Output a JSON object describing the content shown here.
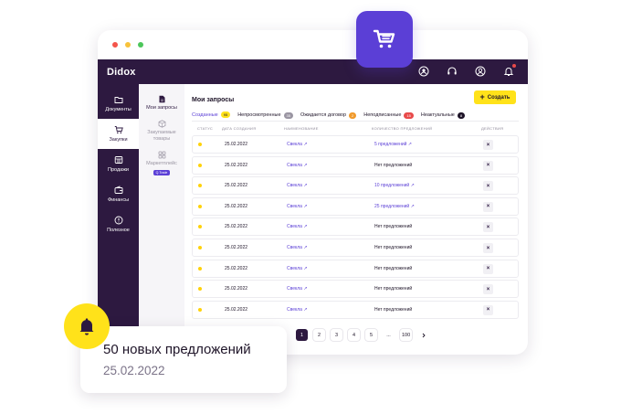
{
  "app": {
    "logo": "Didox"
  },
  "titlebar": {
    "dot_colors": [
      "#f4554b",
      "#f8c23a",
      "#4cc65a"
    ]
  },
  "topbar": {
    "icons": [
      "user-badge-icon",
      "headset-icon",
      "profile-icon",
      "bell-icon"
    ]
  },
  "sidebar": {
    "items": [
      {
        "label": "Документы",
        "icon": "document-icon",
        "active": false
      },
      {
        "label": "Закупки",
        "icon": "cart-icon",
        "active": true
      },
      {
        "label": "Продажи",
        "icon": "store-icon",
        "active": false
      },
      {
        "label": "Финансы",
        "icon": "wallet-icon",
        "active": false
      },
      {
        "label": "Полезное",
        "icon": "info-icon",
        "active": false
      }
    ]
  },
  "subnav": {
    "items": [
      {
        "label": "Мои запросы",
        "icon": "file-icon",
        "active": true
      },
      {
        "label": "Закупаемые товары",
        "icon": "box-icon",
        "active": false
      },
      {
        "label": "Маркетплейс",
        "icon": "grid-icon",
        "active": false,
        "badge": "Q.Trade"
      }
    ]
  },
  "main": {
    "title": "Мои запросы",
    "create_label": "Создать",
    "tabs": [
      {
        "label": "Созданные",
        "count": "95",
        "badge_color": "#ffe21a",
        "badge_text_color": "#1e1428",
        "active": true
      },
      {
        "label": "Непросмотренные",
        "count": "35",
        "badge_color": "#9a95a2",
        "badge_text_color": "#ffffff",
        "active": false
      },
      {
        "label": "Ожидается договор",
        "count": "2",
        "badge_color": "#f09a2c",
        "badge_text_color": "#ffffff",
        "active": false
      },
      {
        "label": "Неподписанные",
        "count": "15",
        "badge_color": "#e84a4a",
        "badge_text_color": "#ffffff",
        "active": false
      },
      {
        "label": "Неактуальные",
        "count": "8",
        "badge_color": "#1e1428",
        "badge_text_color": "#ffffff",
        "active": false
      }
    ],
    "columns": [
      "СТАТУС",
      "ДАТА СОЗДАНИЯ",
      "НАИМЕНОВАНИЕ",
      "КОЛИЧЕСТВО ПРЕДЛОЖЕНИЙ",
      "ДЕЙСТВИЯ"
    ],
    "rows": [
      {
        "date": "25.02.2022",
        "name": "Свекла ↗",
        "offers": "5 предложений ↗",
        "offers_link": true
      },
      {
        "date": "25.02.2022",
        "name": "Свекла ↗",
        "offers": "Нет предложений",
        "offers_link": false
      },
      {
        "date": "25.02.2022",
        "name": "Свекла ↗",
        "offers": "10 предложений ↗",
        "offers_link": true
      },
      {
        "date": "25.02.2022",
        "name": "Свекла ↗",
        "offers": "25 предложений ↗",
        "offers_link": true
      },
      {
        "date": "25.02.2022",
        "name": "Свекла ↗",
        "offers": "Нет предложений",
        "offers_link": false
      },
      {
        "date": "25.02.2022",
        "name": "Свекла ↗",
        "offers": "Нет предложений",
        "offers_link": false
      },
      {
        "date": "25.02.2022",
        "name": "Свекла ↗",
        "offers": "Нет предложений",
        "offers_link": false
      },
      {
        "date": "25.02.2022",
        "name": "Свекла ↗",
        "offers": "Нет предложений",
        "offers_link": false
      },
      {
        "date": "25.02.2022",
        "name": "Свекла ↗",
        "offers": "Нет предложений",
        "offers_link": false
      }
    ],
    "pagination": [
      "1",
      "2",
      "3",
      "4",
      "5",
      "...",
      "100"
    ],
    "current_page": "1"
  },
  "notification": {
    "title": "50 новых предложений",
    "date": "25.02.2022"
  },
  "colors": {
    "brand": "#2d1940",
    "accent": "#5b3fd6",
    "highlight": "#ffe21a"
  }
}
